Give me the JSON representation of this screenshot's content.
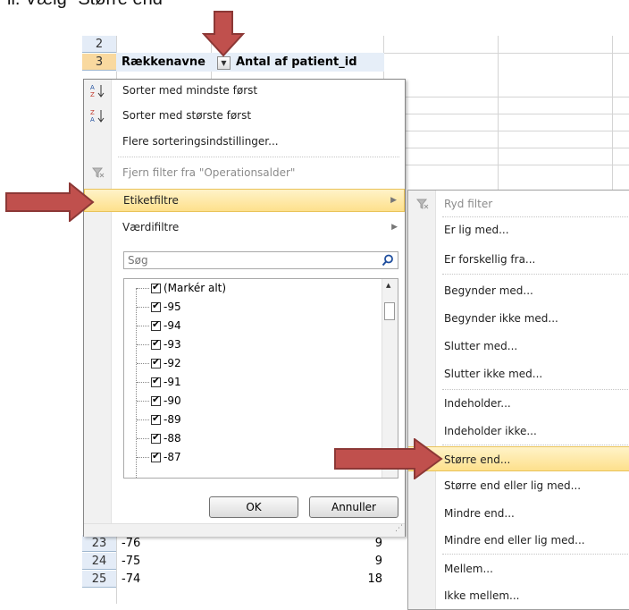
{
  "heading": "ii.   Vælg \"Større end\"",
  "grid": {
    "rows_top": [
      "2",
      "3"
    ],
    "row3_col_a": "Rækkenavne",
    "row3_col_b": "Antal af patient_id",
    "rows_bottom": [
      {
        "num": "23",
        "label": "-76",
        "value": "9"
      },
      {
        "num": "24",
        "label": "-75",
        "value": "9"
      },
      {
        "num": "25",
        "label": "-74",
        "value": "18"
      }
    ]
  },
  "menu": {
    "sort_asc": "Sorter med mindste først",
    "sort_desc": "Sorter med største først",
    "more_sort": "Flere sorteringsindstillinger...",
    "clear_filter": "Fjern filter fra \"Operationsalder\"",
    "label_filters": "Etiketfiltre",
    "value_filters": "Værdifiltre",
    "search_placeholder": "Søg",
    "list_items": [
      "(Markér alt)",
      "-95",
      "-94",
      "-93",
      "-92",
      "-91",
      "-90",
      "-89",
      "-88",
      "-87"
    ],
    "ok": "OK",
    "cancel": "Annuller"
  },
  "submenu": {
    "items": [
      {
        "label": "Ryd filter",
        "disabled": true
      },
      {
        "label": "Er lig med..."
      },
      {
        "label": "Er forskellig fra..."
      },
      {
        "label": "Begynder med..."
      },
      {
        "label": "Begynder ikke med..."
      },
      {
        "label": "Slutter med..."
      },
      {
        "label": "Slutter ikke med..."
      },
      {
        "label": "Indeholder..."
      },
      {
        "label": "Indeholder ikke..."
      },
      {
        "label": "Større end...",
        "highlighted": true
      },
      {
        "label": "Større end eller lig med..."
      },
      {
        "label": "Mindre end..."
      },
      {
        "label": "Mindre end eller lig med..."
      },
      {
        "label": "Mellem..."
      },
      {
        "label": "Ikke mellem..."
      }
    ]
  },
  "colors": {
    "highlight": "#fde08c",
    "arrow_fill": "#c0504d",
    "arrow_stroke": "#8c3836",
    "row_header": "#e4ecf7",
    "row_header_selected": "#f9d99f"
  }
}
